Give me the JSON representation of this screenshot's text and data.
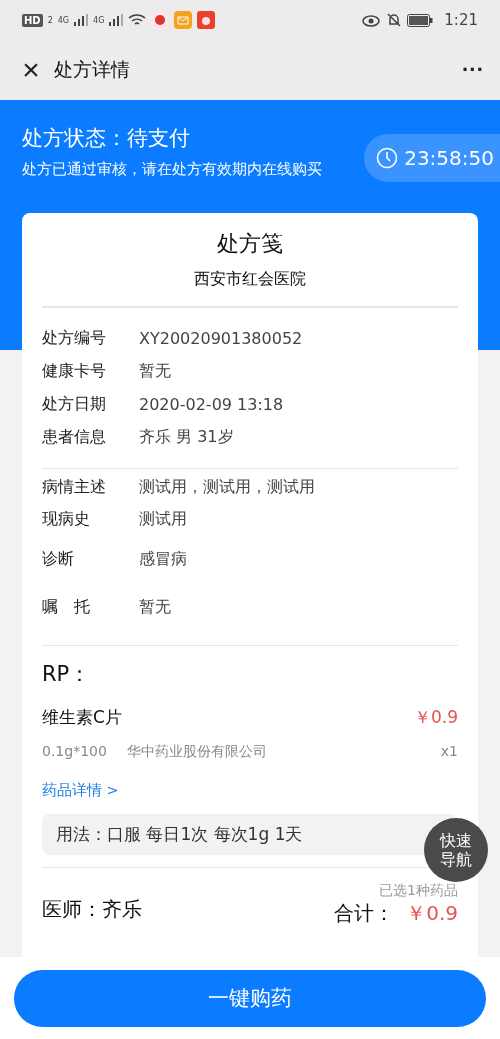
{
  "status_bar": {
    "hd": "HD",
    "hd_sub": "2",
    "signals": [
      "4G",
      "4G"
    ],
    "time": "1:21"
  },
  "header": {
    "close": "×",
    "title": "处方详情",
    "more": "···"
  },
  "status": {
    "title": "处方状态：待支付",
    "note": "处方已通过审核，请在处方有效期内在线购买",
    "countdown": "23:58:50"
  },
  "card": {
    "title": "处方笺",
    "hospital": "西安市红会医院",
    "info": [
      {
        "label": "处方编号",
        "value": "XY20020901380052"
      },
      {
        "label": "健康卡号",
        "value": "暂无"
      },
      {
        "label": "处方日期",
        "value": "2020-02-09 13:18"
      },
      {
        "label": "患者信息",
        "value": "齐乐 男 31岁"
      }
    ],
    "clinical": [
      {
        "label": "病情主述",
        "value": "测试用，测试用，测试用",
        "spaced": false
      },
      {
        "label": "现病史",
        "value": "测试用",
        "spaced": false
      },
      {
        "label": "诊断",
        "value": "感冒病",
        "spaced": true
      },
      {
        "label": "嘱　托",
        "value": "暂无",
        "spaced": true
      }
    ],
    "rp_title": "RP：",
    "drugs": [
      {
        "name": "维生素C片",
        "price": "￥0.9",
        "spec": "0.1g*100",
        "maker": "华中药业股份有限公司",
        "qty": "x1",
        "link": "药品详情 >",
        "usage": "用法：口服 每日1次 每次1g 1天"
      }
    ],
    "doctor": "医师：齐乐",
    "selected_count": "已选1种药品",
    "total_label": "合计：",
    "total": "￥0.9"
  },
  "quick_nav": "快速导航",
  "buy_button": "一键购药"
}
